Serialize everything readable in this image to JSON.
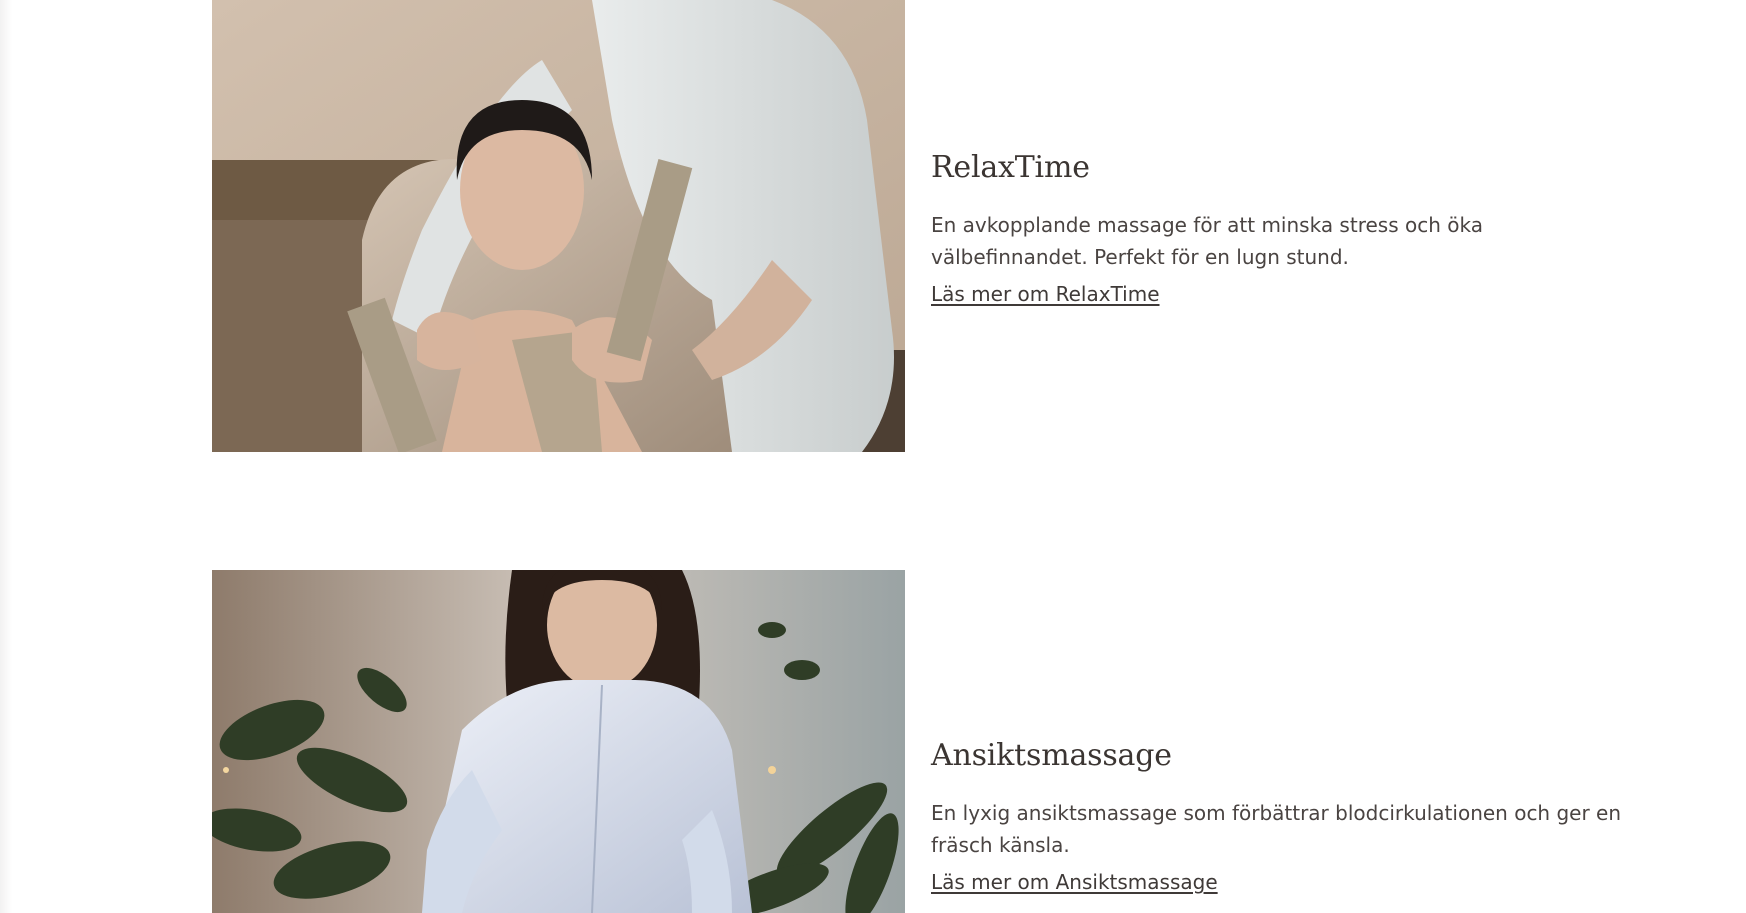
{
  "services": [
    {
      "title": "RelaxTime",
      "description": "En avkopplande massage för att minska stress och öka välbefinnandet. Perfekt för en lugn stund.",
      "link_label": "Läs mer om RelaxTime",
      "image_alt": "massage-photo"
    },
    {
      "title": "Ansiktsmassage",
      "description": "En lyxig ansiktsmassage som förbättrar blodcirkulationen och ger en fräsch känsla.",
      "link_label": "Läs mer om Ansiktsmassage",
      "image_alt": "facial-massage-photo"
    }
  ]
}
